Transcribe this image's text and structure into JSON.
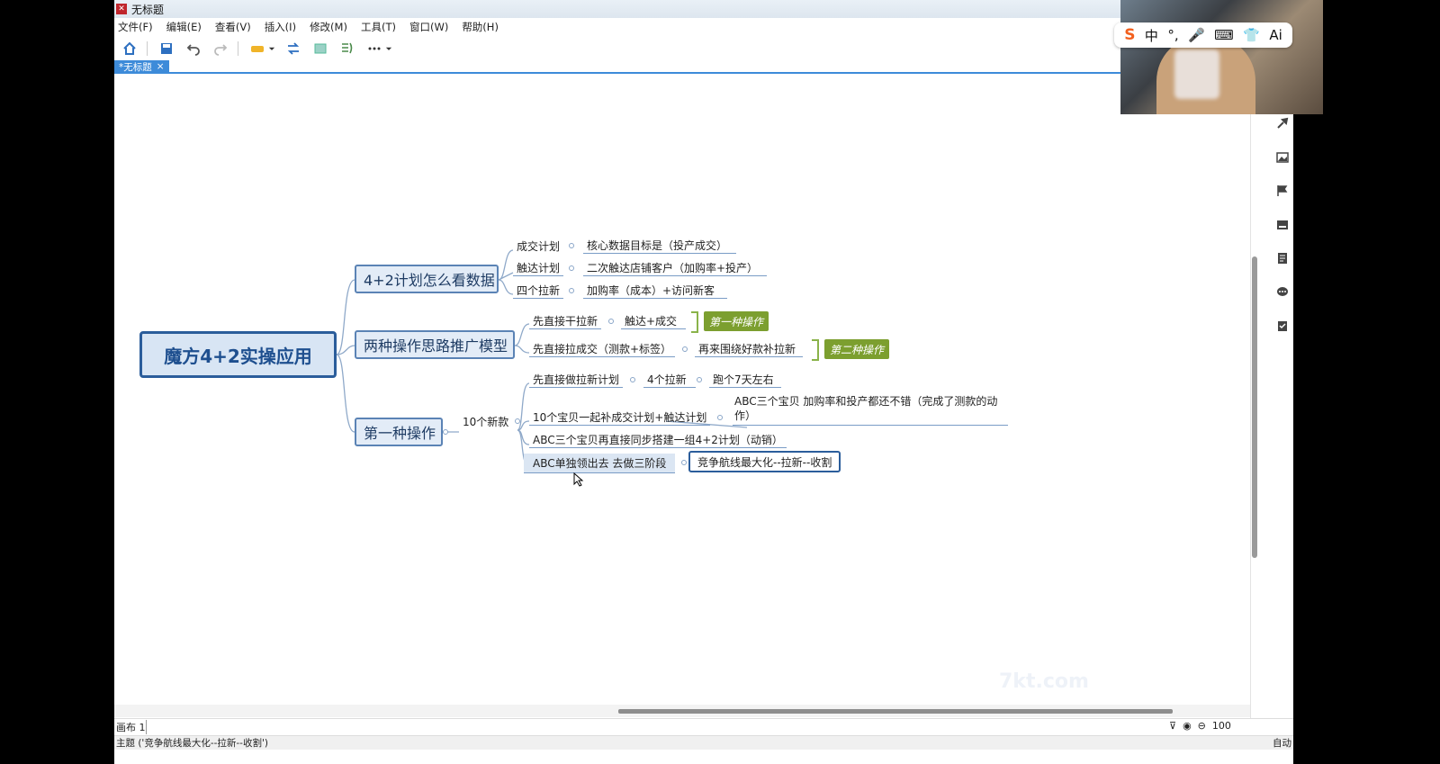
{
  "window": {
    "title": "无标题"
  },
  "menu": [
    "文件(F)",
    "编辑(E)",
    "查看(V)",
    "插入(I)",
    "修改(M)",
    "工具(T)",
    "窗口(W)",
    "帮助(H)"
  ],
  "toolbar": {
    "icons": [
      "home-icon",
      "save-icon",
      "undo-icon",
      "redo-icon",
      "topic-style-icon",
      "dropdown-arrow-icon",
      "relationship-icon",
      "boundary-icon",
      "summary-icon",
      "more-icon"
    ]
  },
  "tab": {
    "label": "*无标题",
    "close": "×"
  },
  "mindmap": {
    "central": "魔方4+2实操应用",
    "branch1": {
      "title": "4+2计划怎么看数据",
      "items": [
        {
          "label": "成交计划",
          "detail": "核心数据目标是（投产成交）"
        },
        {
          "label": "触达计划",
          "detail": "二次触达店铺客户（加购率+投产）"
        },
        {
          "label": "四个拉新",
          "detail": "加购率（成本）+访问新客"
        }
      ]
    },
    "branch2": {
      "title": "两种操作思路推广模型",
      "items": [
        {
          "label": "先直接干拉新",
          "detail": "触达+成交",
          "tag": "第一种操作"
        },
        {
          "label": "先直接拉成交（测款+标签）",
          "detail": "再来围绕好款补拉新",
          "tag": "第二种操作"
        }
      ]
    },
    "branch3": {
      "title": "第一种操作",
      "mid": "10个新款",
      "items": [
        {
          "label": "先直接做拉新计划",
          "detail": "4个拉新",
          "detail2": "跑个7天左右"
        },
        {
          "label": "10个宝贝一起补成交计划+触达计划",
          "detail": "ABC三个宝贝 加购率和投产都还不错（完成了测款的动作）"
        },
        {
          "label": "ABC三个宝贝再直接同步搭建一组4+2计划（动销）"
        },
        {
          "label": "ABC单独领出去  去做三阶段",
          "detail": "竞争航线最大化--拉新--收割"
        }
      ]
    }
  },
  "sheetbar": {
    "sheet": "画布 1",
    "zoom": "100"
  },
  "statusbar": {
    "left": "主题 ('竞争航线最大化--拉新--收割')",
    "right": "自动"
  },
  "ime": {
    "items": [
      "S",
      "中",
      "°,",
      "🎤",
      "⌨",
      "👕",
      "Ai"
    ]
  },
  "watermark": "7kt.com",
  "colors": {
    "accent": "#3d8bd9",
    "central_border": "#2b5d9b",
    "tag_green": "#7c9f2f"
  }
}
